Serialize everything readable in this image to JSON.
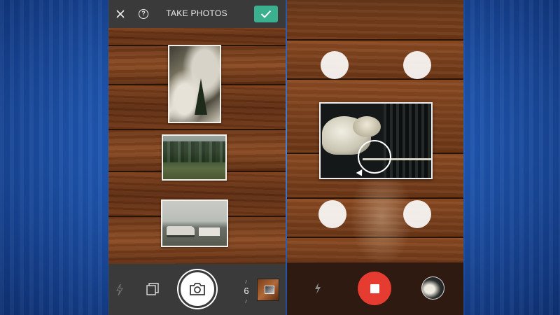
{
  "left_screen": {
    "header": {
      "title": "TAKE PHOTOS",
      "close_icon": "close-icon",
      "help_icon": "help-icon",
      "help_glyph": "?",
      "confirm_icon": "checkmark-icon",
      "confirm_color": "#3bb08f"
    },
    "photos": [
      {
        "name": "snowy-forest-photo"
      },
      {
        "name": "campsite-photo"
      },
      {
        "name": "van-photo"
      }
    ],
    "toolbar": {
      "flash_icon": "flash-off-icon",
      "layers_icon": "layers-icon",
      "shutter_icon": "camera-icon",
      "photo_count": "6",
      "thumbnail_icon": "last-photo-thumbnail"
    }
  },
  "right_screen": {
    "corner_markers": 4,
    "focus_icon": "focus-ring-icon",
    "toolbar": {
      "flash_icon": "flash-icon",
      "record_icon": "stop-icon",
      "record_color": "#e53b30",
      "thumbnail_icon": "last-scan-thumbnail"
    }
  }
}
